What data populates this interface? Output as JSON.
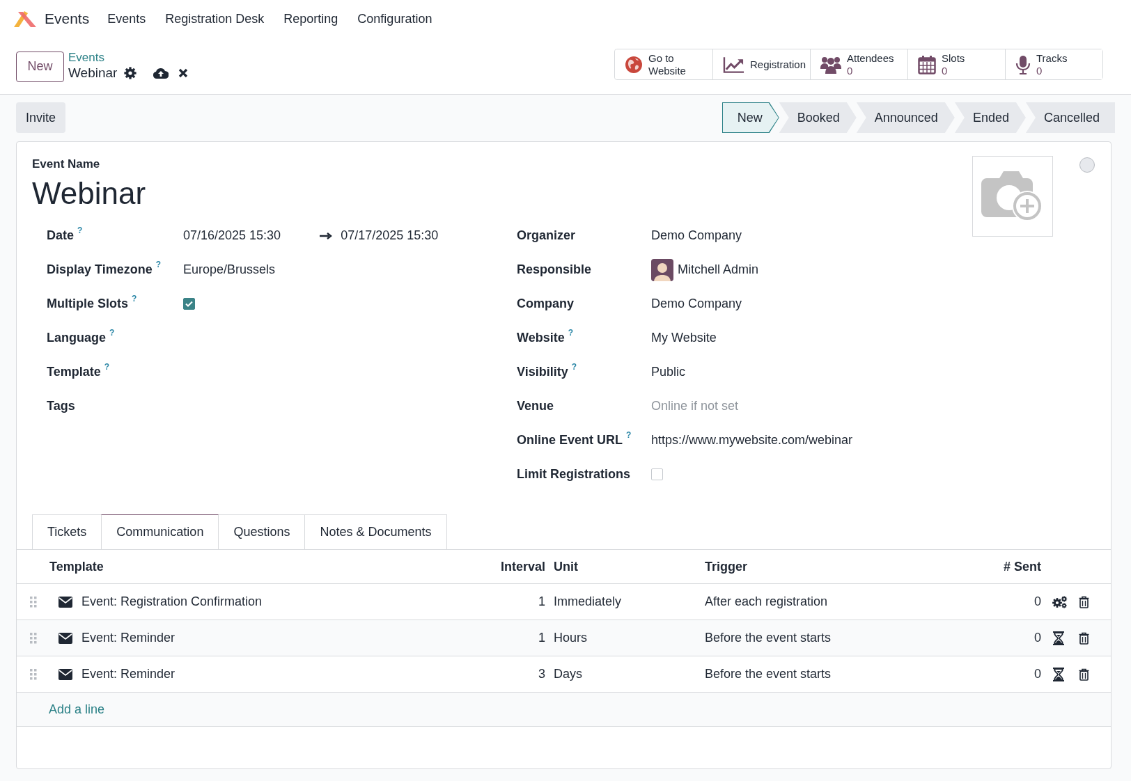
{
  "nav": {
    "app_name": "Events",
    "menu": [
      "Events",
      "Registration Desk",
      "Reporting",
      "Configuration"
    ]
  },
  "control_panel": {
    "new_button": "New",
    "breadcrumb_parent": "Events",
    "record": "Webinar"
  },
  "smart_buttons": [
    {
      "kind": "globe",
      "label": "Go to Website"
    },
    {
      "kind": "chart",
      "label": "Registration"
    },
    {
      "kind": "people",
      "label": "Attendees",
      "count": "0"
    },
    {
      "kind": "calendar",
      "label": "Slots",
      "count": "0"
    },
    {
      "kind": "microphone",
      "label": "Tracks",
      "count": "0"
    }
  ],
  "status_bar": {
    "action": "Invite",
    "stages": [
      {
        "label": "New",
        "selected": true
      },
      {
        "label": "Booked",
        "selected": false
      },
      {
        "label": "Announced",
        "selected": false
      },
      {
        "label": "Ended",
        "selected": false
      },
      {
        "label": "Cancelled",
        "selected": false
      }
    ]
  },
  "form": {
    "name_label": "Event Name",
    "name": "Webinar",
    "left": [
      {
        "label": "Date",
        "help": "?",
        "kind": "daterange",
        "start": "07/16/2025 15:30",
        "end": "07/17/2025 15:30"
      },
      {
        "label": "Display Timezone",
        "help": "?",
        "kind": "text",
        "value": "Europe/Brussels"
      },
      {
        "label": "Multiple Slots",
        "help": "?",
        "kind": "checkbox",
        "checked": true
      },
      {
        "label": "Language",
        "help": "?",
        "kind": "empty"
      },
      {
        "label": "Template",
        "help": "?",
        "kind": "empty"
      },
      {
        "label": "Tags",
        "kind": "empty"
      }
    ],
    "right": [
      {
        "label": "Organizer",
        "kind": "text",
        "value": "Demo Company"
      },
      {
        "label": "Responsible",
        "kind": "user",
        "value": "Mitchell Admin"
      },
      {
        "label": "Company",
        "kind": "text",
        "value": "Demo Company"
      },
      {
        "label": "Website",
        "help": "?",
        "kind": "text",
        "value": "My Website"
      },
      {
        "label": "Visibility",
        "help": "?",
        "kind": "text",
        "value": "Public"
      },
      {
        "label": "Venue",
        "kind": "text",
        "placeholder": "Online if not set"
      },
      {
        "label": "Online Event URL",
        "help": "?",
        "kind": "text",
        "value": "https://www.mywebsite.com/webinar"
      },
      {
        "label": "Limit Registrations",
        "kind": "checkbox",
        "checked": false
      }
    ]
  },
  "tabs": [
    {
      "label": "Tickets",
      "selected": false
    },
    {
      "label": "Communication",
      "selected": true
    },
    {
      "label": "Questions",
      "selected": false
    },
    {
      "label": "Notes & Documents",
      "selected": false
    }
  ],
  "table": {
    "columns": [
      "Template",
      "Interval",
      "Unit",
      "Trigger",
      "# Sent"
    ],
    "rows": [
      {
        "template": "Event: Registration Confirmation",
        "interval": "1",
        "unit": "Immediately",
        "trigger": "After each registration",
        "sent": "0",
        "kind": "gears"
      },
      {
        "template": "Event: Reminder",
        "interval": "1",
        "unit": "Hours",
        "trigger": "Before the event starts",
        "sent": "0",
        "kind": "hourglass"
      },
      {
        "template": "Event: Reminder",
        "interval": "3",
        "unit": "Days",
        "trigger": "Before the event starts",
        "sent": "0",
        "kind": "hourglass"
      }
    ],
    "add_line": "Add a line"
  }
}
